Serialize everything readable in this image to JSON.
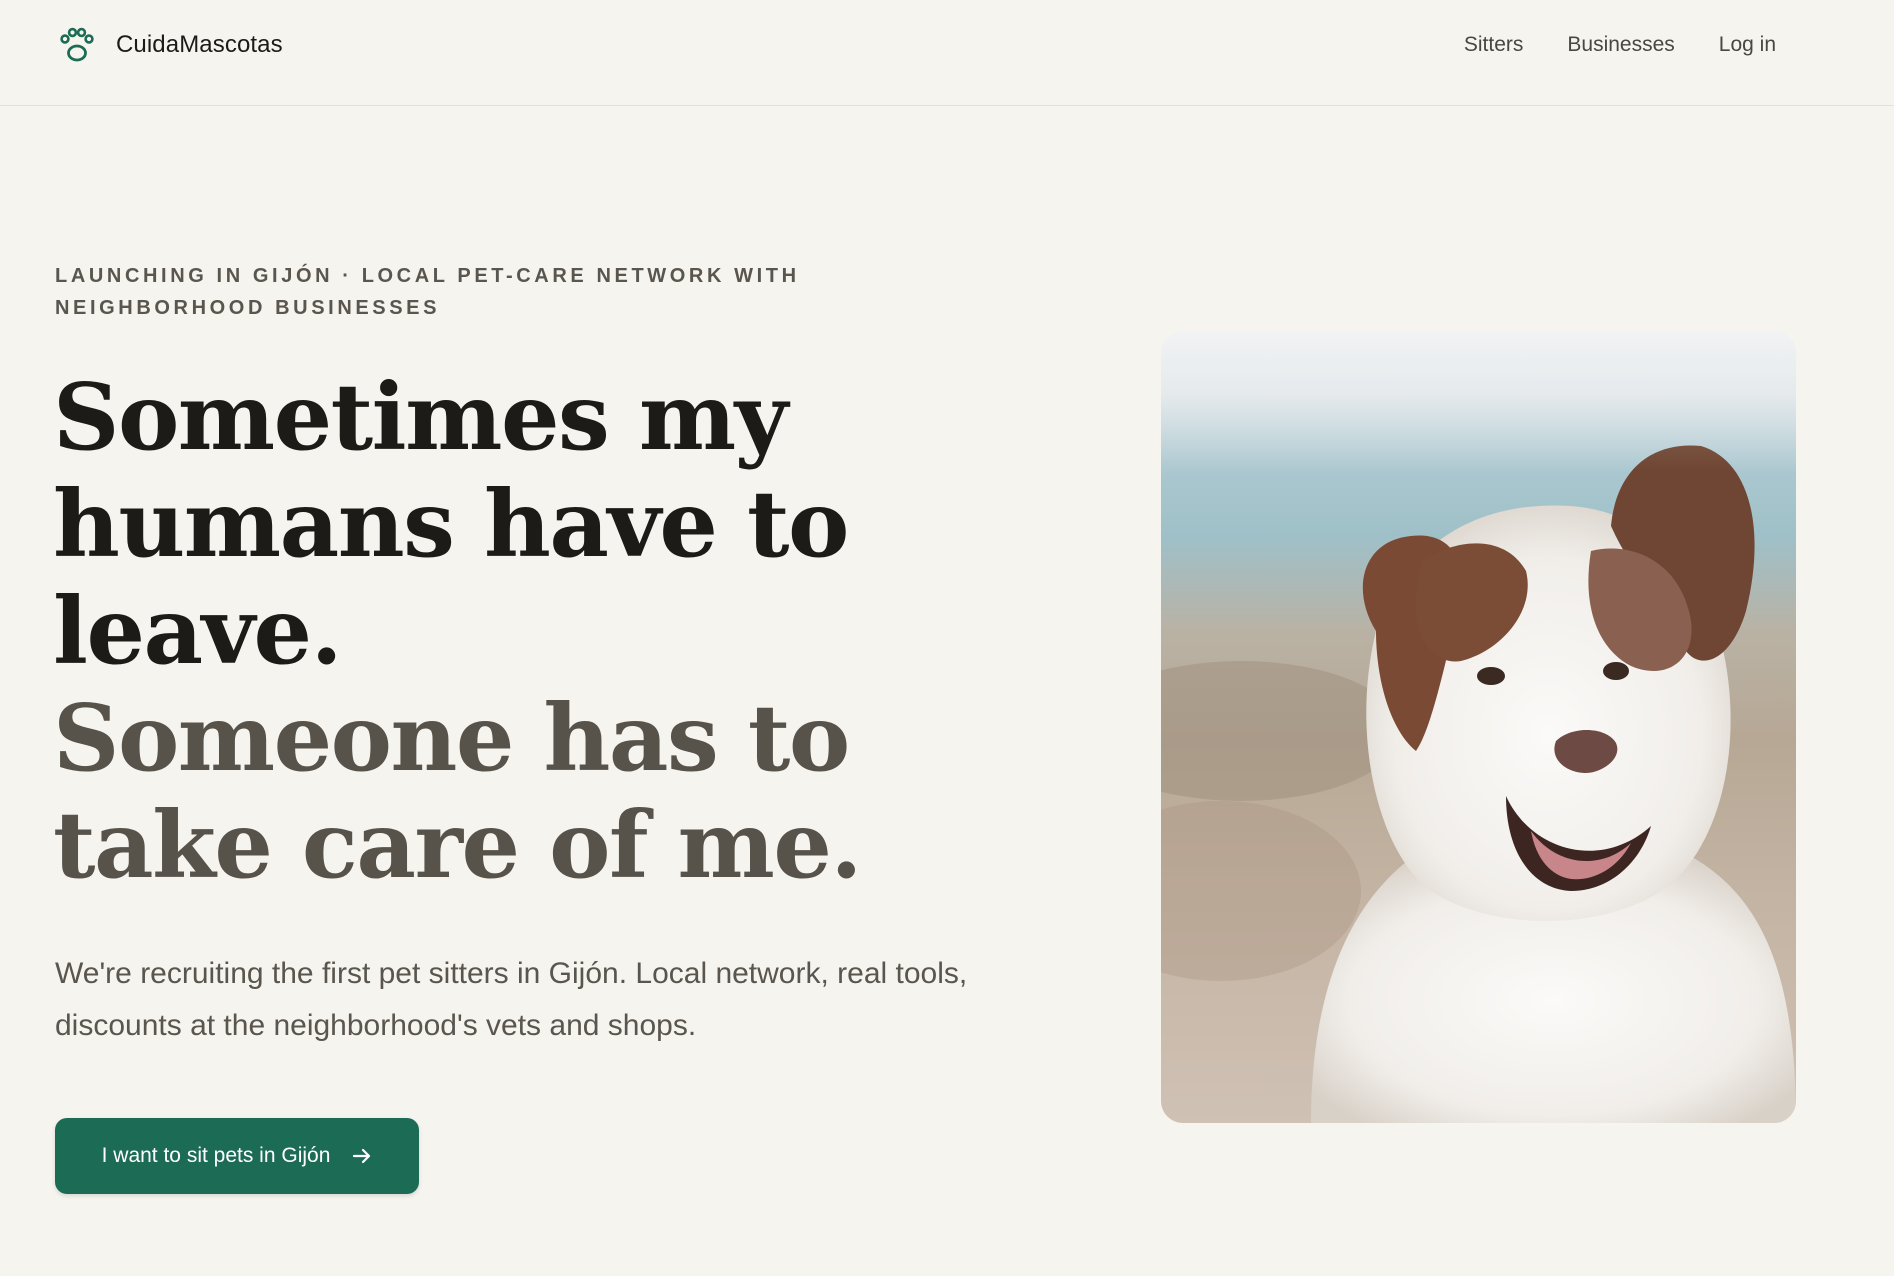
{
  "header": {
    "brand_name": "CuidaMascotas",
    "nav": [
      {
        "label": "Sitters"
      },
      {
        "label": "Businesses"
      },
      {
        "label": "Log in"
      }
    ]
  },
  "hero": {
    "eyebrow": "LAUNCHING IN GIJÓN · LOCAL PET-CARE NETWORK WITH NEIGHBORHOOD BUSINESSES",
    "headline_primary": "Sometimes my humans have to leave.",
    "headline_secondary": "Someone has to take care of me.",
    "subcopy": "We're recruiting the first pet sitters in Gijón. Local network, real tools, discounts at the neighborhood's vets and shops.",
    "cta_label": "I want to sit pets in Gijón"
  },
  "icons": {
    "brand": "paw-icon",
    "cta": "arrow-right-icon"
  },
  "colors": {
    "background": "#f6f4ef",
    "accent": "#1c6b55",
    "headline_dark": "#1d1b17",
    "headline_muted": "#57534b"
  }
}
